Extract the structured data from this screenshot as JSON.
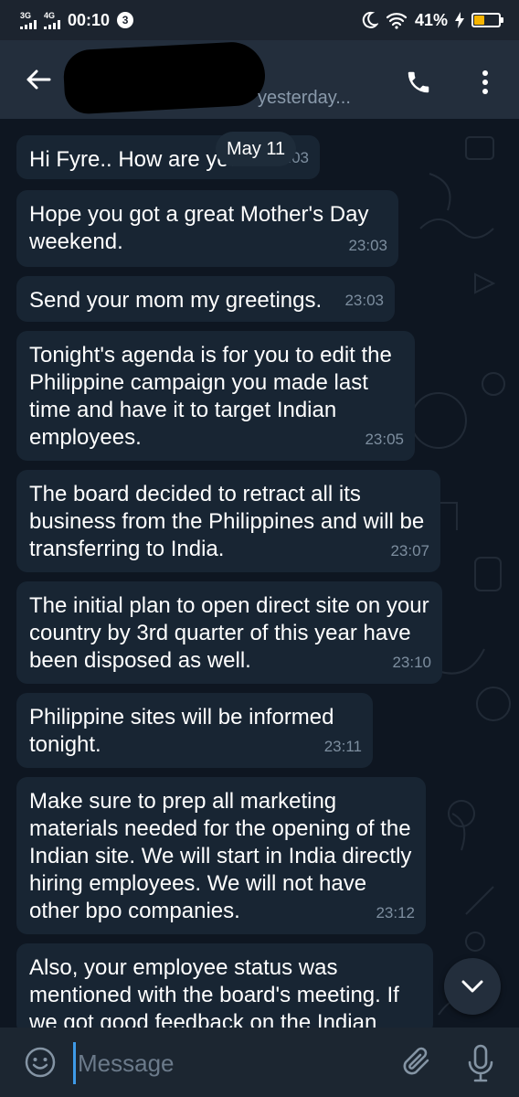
{
  "status_bar": {
    "network1": "3G",
    "network2": "4G",
    "time": "00:10",
    "notification_count": "3",
    "battery_percent": "41%",
    "battery_level": 0.41,
    "battery_color": "#f6b400"
  },
  "header": {
    "last_seen": "yesterday...",
    "back_icon": "arrow-left-icon",
    "call_icon": "phone-icon",
    "menu_icon": "more-vertical-icon"
  },
  "chat": {
    "date_label": "May 11",
    "messages": [
      {
        "text": "Hi Fyre.. How are you?",
        "time": "23:03"
      },
      {
        "text": "Hope you got a great Mother's Day weekend.",
        "time": "23:03"
      },
      {
        "text": "Send your mom my greetings.",
        "time": "23:03"
      },
      {
        "text": "Tonight's agenda is for you to edit the Philippine campaign you made last time and have it to target Indian employees.",
        "time": "23:05"
      },
      {
        "text": "The board decided to retract all its business from the Philippines and will be transferring to India.",
        "time": "23:07"
      },
      {
        "text": "The initial plan to open direct site on your country by 3rd quarter of this year have been disposed as well.",
        "time": "23:10"
      },
      {
        "text": "Philippine sites will be informed tonight.",
        "time": "23:11"
      },
      {
        "text": "Make sure to prep all marketing materials needed for the opening of the Indian site. We will start in India directly hiring employees. We will not have other bpo companies.",
        "time": "23:12"
      },
      {
        "text": "Also, your employee status was mentioned with the board's meeting. If we got good feedback on the Indian",
        "time": ""
      }
    ]
  },
  "input": {
    "placeholder": "Message"
  },
  "colors": {
    "background": "#0e1621",
    "bubble": "#182533",
    "header": "#232e3c",
    "accent": "#3e9ae8"
  }
}
